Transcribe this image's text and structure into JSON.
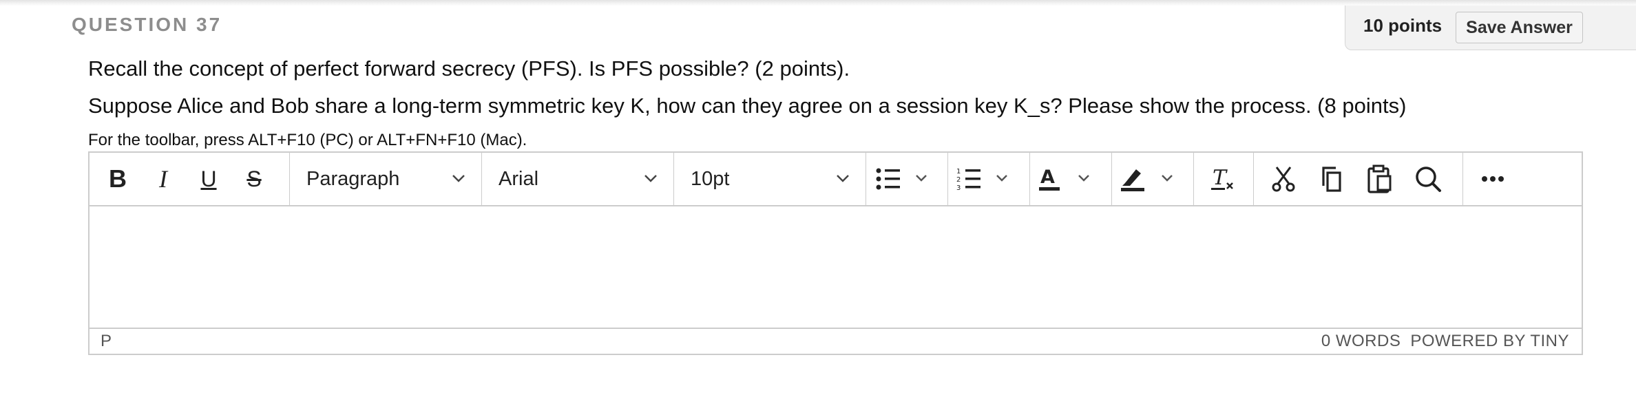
{
  "question": {
    "title": "QUESTION 37",
    "points": "10 points",
    "save_label": "Save Answer",
    "lines": [
      "Recall the concept of perfect forward secrecy (PFS). Is PFS possible? (2 points).",
      "Suppose Alice and Bob share a long-term symmetric key K, how can they agree on a session key K_s? Please show the process. (8 points)"
    ]
  },
  "editor": {
    "toolbar_hint": "For the toolbar, press ALT+F10 (PC) or ALT+FN+F10 (Mac).",
    "bold": "B",
    "italic": "I",
    "underline": "U",
    "strikethrough": "S",
    "block_format": "Paragraph",
    "font_family": "Arial",
    "font_size": "10pt",
    "status_path": "P",
    "word_count": "0 WORDS",
    "powered_by": "POWERED BY TINY"
  },
  "icons": [
    "bold-icon",
    "italic-icon",
    "underline-icon",
    "strikethrough-icon",
    "chevron-down-icon",
    "bullet-list-icon",
    "numbered-list-icon",
    "text-color-icon",
    "highlight-color-icon",
    "clear-formatting-icon",
    "cut-icon",
    "copy-icon",
    "paste-icon",
    "search-icon",
    "more-icon"
  ],
  "colors": {
    "title_gray": "#8d8d8d",
    "border": "#cccccc",
    "panel_bg": "#f2f2f2"
  }
}
